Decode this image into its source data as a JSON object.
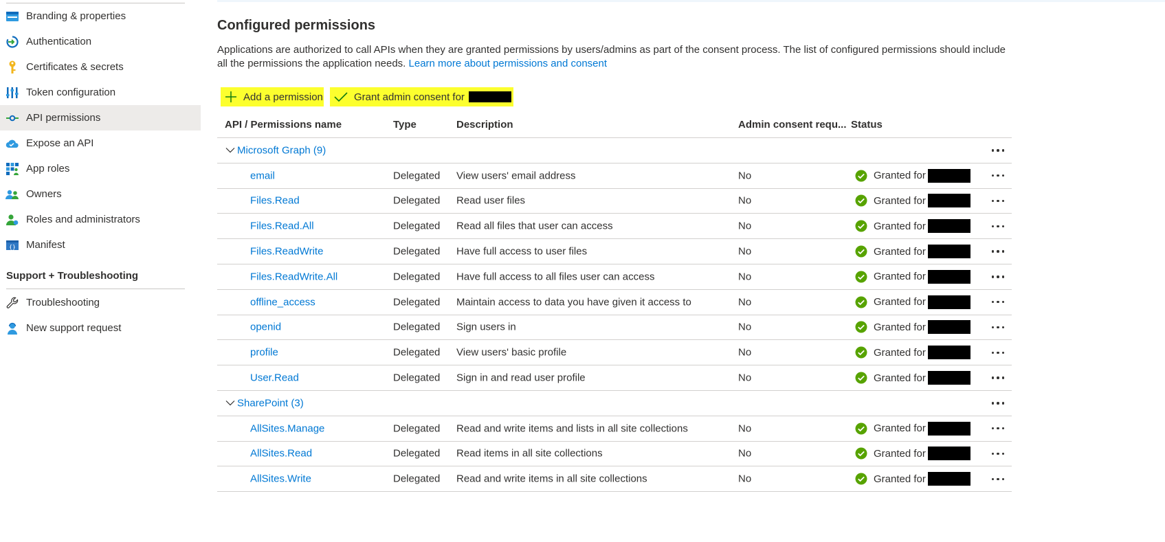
{
  "sidebar": {
    "items": [
      {
        "label": "Branding & properties",
        "icon": "branding-icon"
      },
      {
        "label": "Authentication",
        "icon": "authentication-icon"
      },
      {
        "label": "Certificates & secrets",
        "icon": "key-icon"
      },
      {
        "label": "Token configuration",
        "icon": "token-configuration-icon"
      },
      {
        "label": "API permissions",
        "icon": "api-permissions-icon",
        "active": true
      },
      {
        "label": "Expose an API",
        "icon": "cloud-icon"
      },
      {
        "label": "App roles",
        "icon": "app-roles-icon"
      },
      {
        "label": "Owners",
        "icon": "owners-icon"
      },
      {
        "label": "Roles and administrators",
        "icon": "roles-admin-icon"
      },
      {
        "label": "Manifest",
        "icon": "manifest-icon"
      }
    ],
    "support_section": {
      "title": "Support + Troubleshooting",
      "items": [
        {
          "label": "Troubleshooting",
          "icon": "wrench-icon"
        },
        {
          "label": "New support request",
          "icon": "support-person-icon"
        }
      ]
    }
  },
  "main": {
    "title": "Configured permissions",
    "description": "Applications are authorized to call APIs when they are granted permissions by users/admins as part of the consent process. The list of configured permissions should include all the permissions the application needs.",
    "learn_more_link": "Learn more about permissions and consent",
    "commands": {
      "add_permission": "Add a permission",
      "grant_admin_consent": "Grant admin consent for"
    },
    "colors": {
      "link": "#0078d4",
      "highlight": "#fcff2e",
      "granted": "#57a300"
    },
    "table": {
      "headers": {
        "name": "API / Permissions name",
        "type": "Type",
        "description": "Description",
        "admin_consent": "Admin consent requ...",
        "status": "Status"
      },
      "groups": [
        {
          "label": "Microsoft Graph (9)",
          "rows": [
            {
              "name": "email",
              "type": "Delegated",
              "description": "View users' email address",
              "admin": "No",
              "status": "Granted for"
            },
            {
              "name": "Files.Read",
              "type": "Delegated",
              "description": "Read user files",
              "admin": "No",
              "status": "Granted for"
            },
            {
              "name": "Files.Read.All",
              "type": "Delegated",
              "description": "Read all files that user can access",
              "admin": "No",
              "status": "Granted for"
            },
            {
              "name": "Files.ReadWrite",
              "type": "Delegated",
              "description": "Have full access to user files",
              "admin": "No",
              "status": "Granted for"
            },
            {
              "name": "Files.ReadWrite.All",
              "type": "Delegated",
              "description": "Have full access to all files user can access",
              "admin": "No",
              "status": "Granted for"
            },
            {
              "name": "offline_access",
              "type": "Delegated",
              "description": "Maintain access to data you have given it access to",
              "admin": "No",
              "status": "Granted for"
            },
            {
              "name": "openid",
              "type": "Delegated",
              "description": "Sign users in",
              "admin": "No",
              "status": "Granted for"
            },
            {
              "name": "profile",
              "type": "Delegated",
              "description": "View users' basic profile",
              "admin": "No",
              "status": "Granted for"
            },
            {
              "name": "User.Read",
              "type": "Delegated",
              "description": "Sign in and read user profile",
              "admin": "No",
              "status": "Granted for"
            }
          ]
        },
        {
          "label": "SharePoint (3)",
          "rows": [
            {
              "name": "AllSites.Manage",
              "type": "Delegated",
              "description": "Read and write items and lists in all site collections",
              "admin": "No",
              "status": "Granted for"
            },
            {
              "name": "AllSites.Read",
              "type": "Delegated",
              "description": "Read items in all site collections",
              "admin": "No",
              "status": "Granted for"
            },
            {
              "name": "AllSites.Write",
              "type": "Delegated",
              "description": "Read and write items in all site collections",
              "admin": "No",
              "status": "Granted for"
            }
          ]
        }
      ]
    }
  }
}
